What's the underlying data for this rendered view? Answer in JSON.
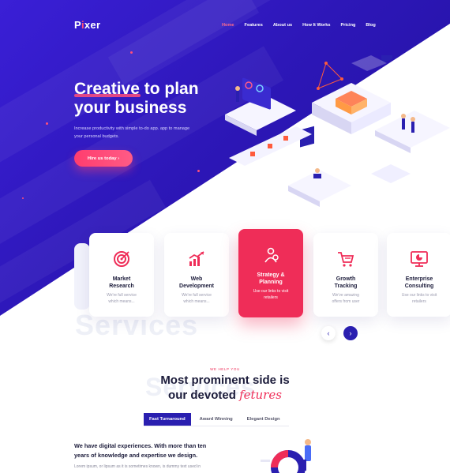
{
  "brand": {
    "logo_prefix": "P",
    "logo_dot": "i",
    "logo_suffix": "xer"
  },
  "nav": {
    "items": [
      "Home",
      "Features",
      "About us",
      "How It Works",
      "Pricing",
      "Blog"
    ],
    "active": "Home"
  },
  "hero": {
    "headline_line1": "Creative to plan",
    "headline_line2": "your business",
    "subtext_line1": "Increase productivity with simple to-do app. app to manage",
    "subtext_line2": "your personal budgets.",
    "cta_label": "Hire us today",
    "cta_arrow": "›"
  },
  "services": {
    "ghost_text": "Services",
    "cards": [
      {
        "title_l1": "Market",
        "title_l2": "Research",
        "desc_l1": "We're full service",
        "desc_l2": "which means...",
        "icon": "target-icon",
        "active": false
      },
      {
        "title_l1": "Web",
        "title_l2": "Development",
        "desc_l1": "We're full service",
        "desc_l2": "which means...",
        "icon": "chart-growth-icon",
        "active": false
      },
      {
        "title_l1": "Strategy &",
        "title_l2": "Planning",
        "desc_l1": "Use our links to visit",
        "desc_l2": "retailers",
        "icon": "strategy-person-icon",
        "active": true
      },
      {
        "title_l1": "Growth",
        "title_l2": "Tracking",
        "desc_l1": "We've amazing",
        "desc_l2": "offers from user",
        "icon": "cart-icon",
        "active": false
      },
      {
        "title_l1": "Enterprise",
        "title_l2": "Consulting",
        "desc_l1": "Use our links to visit",
        "desc_l2": "retailers",
        "icon": "monitor-chart-icon",
        "active": false
      }
    ],
    "prev_label": "‹",
    "next_label": "›"
  },
  "features": {
    "eyebrow": "WE HELP YOU",
    "title_line1": "Most prominent side is",
    "title_line2_plain": "our devoted",
    "title_line2_script": "fetures",
    "ghost_text": "Services",
    "tabs": [
      "Fast Turnaround",
      "Award Winning",
      "Elegant Design"
    ],
    "active_tab": "Fast Turnaround",
    "lead_line1": "We have digital experiences. With more than ten",
    "lead_line2": "years of knowledge and expertise we design.",
    "body_line1": "Lorem ipsum, or lipsum as it is sometimes known, is dummy text used in"
  },
  "colors": {
    "accent": "#ef2d58",
    "primary": "#2a1fb0",
    "hero_bg": "#3a1fd6"
  }
}
